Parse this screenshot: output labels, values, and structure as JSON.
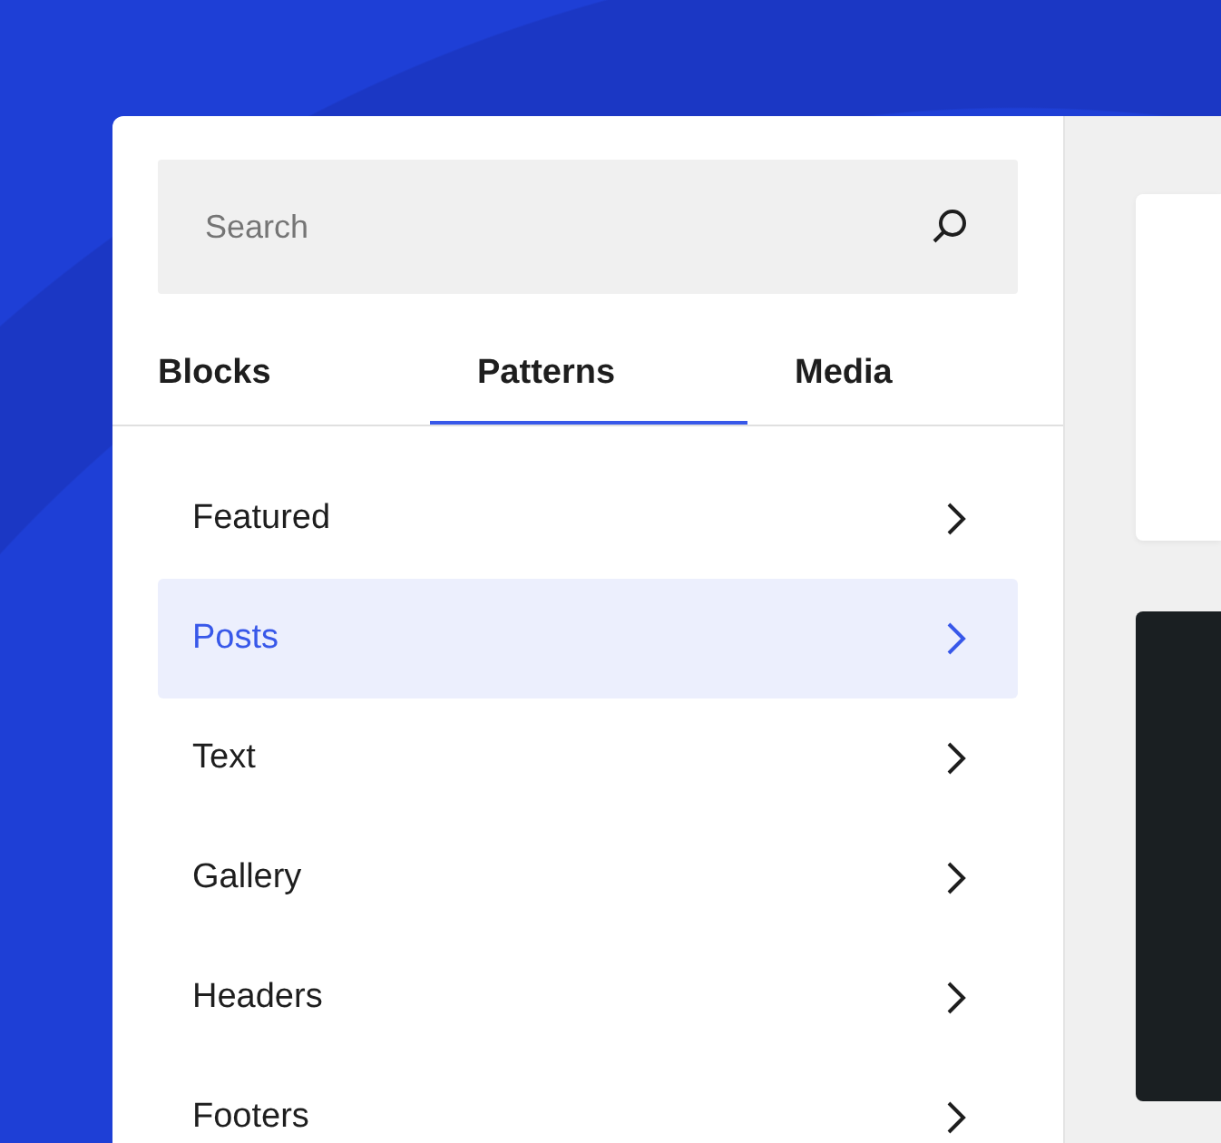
{
  "search": {
    "placeholder": "Search"
  },
  "tabs": [
    {
      "label": "Blocks",
      "selected": false
    },
    {
      "label": "Patterns",
      "selected": true
    },
    {
      "label": "Media",
      "selected": false
    }
  ],
  "categories": [
    {
      "label": "Featured",
      "selected": false
    },
    {
      "label": "Posts",
      "selected": true
    },
    {
      "label": "Text",
      "selected": false
    },
    {
      "label": "Gallery",
      "selected": false
    },
    {
      "label": "Headers",
      "selected": false
    },
    {
      "label": "Footers",
      "selected": false
    }
  ],
  "previews": [
    {
      "kind": "light"
    },
    {
      "kind": "dark"
    }
  ]
}
